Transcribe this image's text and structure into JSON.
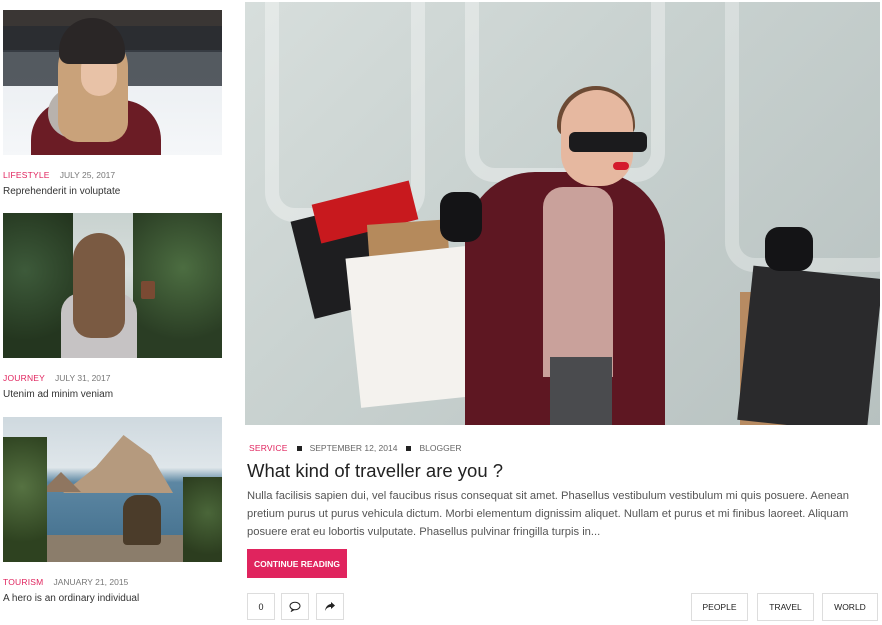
{
  "sidebar": {
    "posts": [
      {
        "category": "LIFESTYLE",
        "date": "JULY 25, 2017",
        "title": "Reprehenderit in voluptate"
      },
      {
        "category": "JOURNEY",
        "date": "JULY 31, 2017",
        "title": "Utenim ad minim veniam"
      },
      {
        "category": "TOURISM",
        "date": "JANUARY 21, 2015",
        "title": "A hero is an ordinary individual"
      }
    ]
  },
  "main": {
    "category": "SERVICE",
    "date": "SEPTEMBER 12, 2014",
    "author": "BLOGGER",
    "title": "What kind of traveller are you ?",
    "excerpt": "Nulla facilisis sapien dui, vel faucibus risus consequat sit amet. Phasellus vestibulum vestibulum mi quis posuere. Aenean pretium purus ut purus vehicula dictum. Morbi elementum dignissim aliquet. Nullam et purus et mi finibus laoreet. Aliquam posuere erat eu lobortis vulputate. Phasellus pulvinar fringilla turpis in...",
    "read_more_label": "CONTINUE READING",
    "comment_count": "0",
    "tags": [
      "PEOPLE",
      "TRAVEL",
      "WORLD"
    ]
  },
  "colors": {
    "accent": "#e0245e"
  },
  "icons": {
    "comment": "speech-bubble-icon",
    "share": "share-arrow-icon"
  }
}
